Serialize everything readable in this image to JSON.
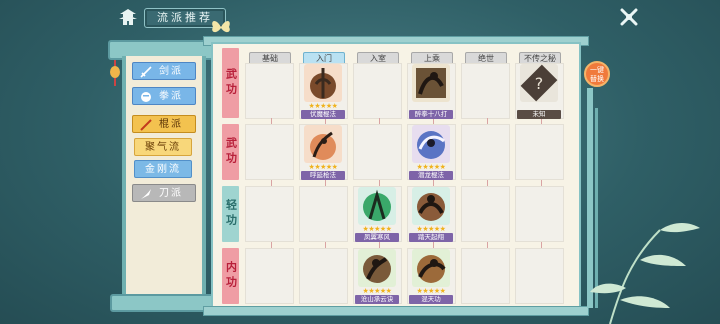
{
  "header": {
    "title": "流派推荐"
  },
  "sidebar": {
    "items": [
      {
        "label": "剑派",
        "style": "blue",
        "icon": "sword-icon"
      },
      {
        "label": "拳派",
        "style": "blue",
        "icon": "fist-icon"
      },
      {
        "label": "棍派",
        "style": "orange",
        "icon": "staff-icon"
      },
      {
        "label": "聚气流",
        "style": "sub-orange"
      },
      {
        "label": "金刚流",
        "style": "sub-blue"
      },
      {
        "label": "刀派",
        "style": "gray",
        "icon": "blade-icon"
      }
    ]
  },
  "columns": [
    "基础",
    "入门",
    "入室",
    "上乘",
    "绝世",
    "不传之秘"
  ],
  "rows": [
    "武功",
    "武功",
    "轻功",
    "内功"
  ],
  "skills": [
    {
      "row": 0,
      "col": 1,
      "name": "伏魔棍法",
      "stars": "★★★★★",
      "bg": "#f6ddc9",
      "name_style": "purple"
    },
    {
      "row": 0,
      "col": 3,
      "name": "醉拳十八打",
      "stars": "",
      "bg": "#ede4cf",
      "name_style": "purple"
    },
    {
      "row": 0,
      "col": 5,
      "name": "未知",
      "stars": "",
      "bg": "#e9e5db",
      "name_style": "dark"
    },
    {
      "row": 1,
      "col": 1,
      "name": "呼延枪法",
      "stars": "★★★★★",
      "bg": "#f6ddc9",
      "name_style": "purple"
    },
    {
      "row": 1,
      "col": 3,
      "name": "潜龙棍法",
      "stars": "★★★★★",
      "bg": "#e7ddef",
      "name_style": "purple"
    },
    {
      "row": 2,
      "col": 2,
      "name": "凤翼寒风",
      "stars": "★★★★★",
      "bg": "#d7efe6",
      "name_style": "purple"
    },
    {
      "row": 2,
      "col": 3,
      "name": "踏天起翔",
      "stars": "★★★★★",
      "bg": "#d7efe6",
      "name_style": "purple"
    },
    {
      "row": 3,
      "col": 2,
      "name": "沧山承云诀",
      "stars": "★★★★★",
      "bg": "#e2f0d6",
      "name_style": "purple"
    },
    {
      "row": 3,
      "col": 3,
      "name": "混天功",
      "stars": "★★★★★",
      "bg": "#e2f0d6",
      "name_style": "purple"
    }
  ],
  "side_badge": {
    "line1": "一键",
    "line2": "替换"
  },
  "colors": {
    "accent": "#86c2c4",
    "row_pink": "#ef9da4",
    "row_teal": "#9fd4d0",
    "name_bar": "#7e64a8"
  }
}
